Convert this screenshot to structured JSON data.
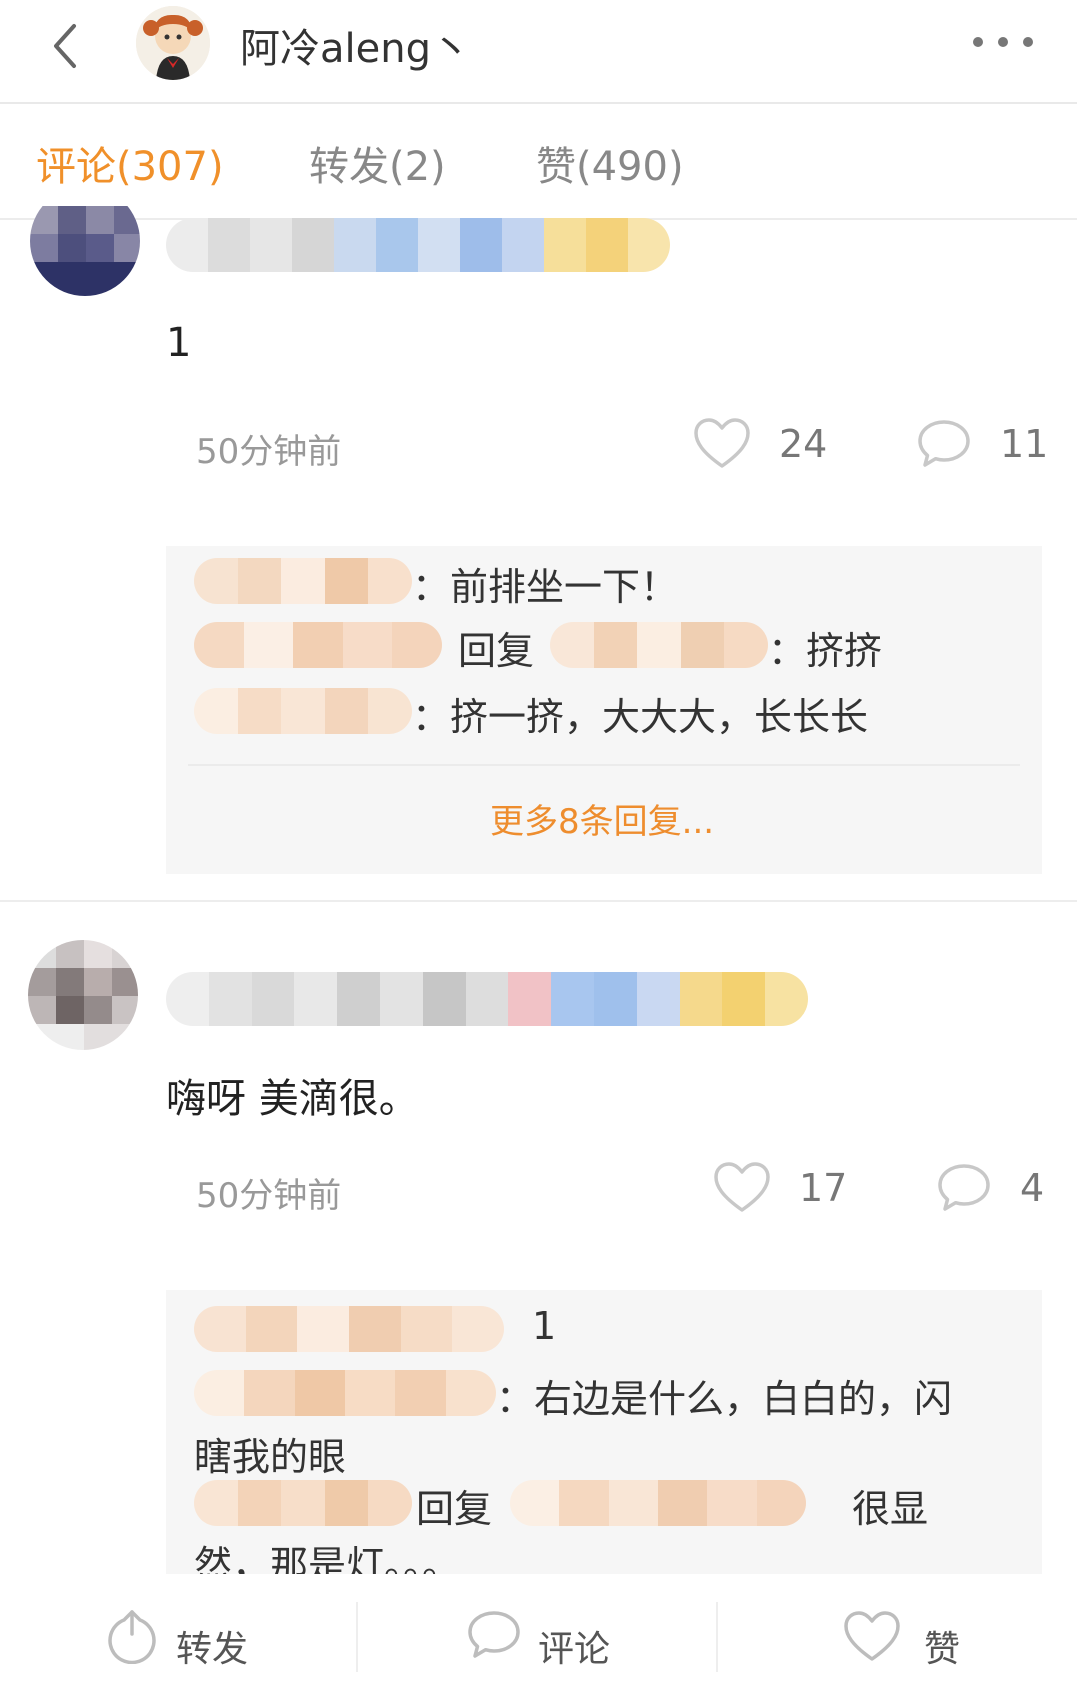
{
  "header": {
    "title": "阿冷aleng丶"
  },
  "tabs": [
    {
      "label": "评论(307)"
    },
    {
      "label": "转发(2)"
    },
    {
      "label": "赞(490)"
    }
  ],
  "comments": [
    {
      "text": "1",
      "time": "50分钟前",
      "likes": "24",
      "replies": "11",
      "reply_preview": [
        {
          "text": "：前排坐一下！"
        },
        {
          "mid": "回复",
          "text": "：挤挤"
        },
        {
          "text": "：挤一挤，大大大，长长长"
        }
      ],
      "more_replies": "更多8条回复..."
    },
    {
      "text": "嗨呀 美滴很。",
      "time": "50分钟前",
      "likes": "17",
      "replies": "4",
      "reply_preview": [
        {
          "text": "1"
        },
        {
          "text": "：右边是什么，白白的，闪",
          "cont": "瞎我的眼"
        },
        {
          "mid": "回复",
          "text": "很显",
          "cont": "然，那是灯。。。"
        }
      ]
    }
  ],
  "bottom_bar": {
    "repost": "转发",
    "comment": "评论",
    "like": "赞"
  },
  "colors": {
    "accent": "#f0902a",
    "more_link": "#ee8d2e"
  }
}
